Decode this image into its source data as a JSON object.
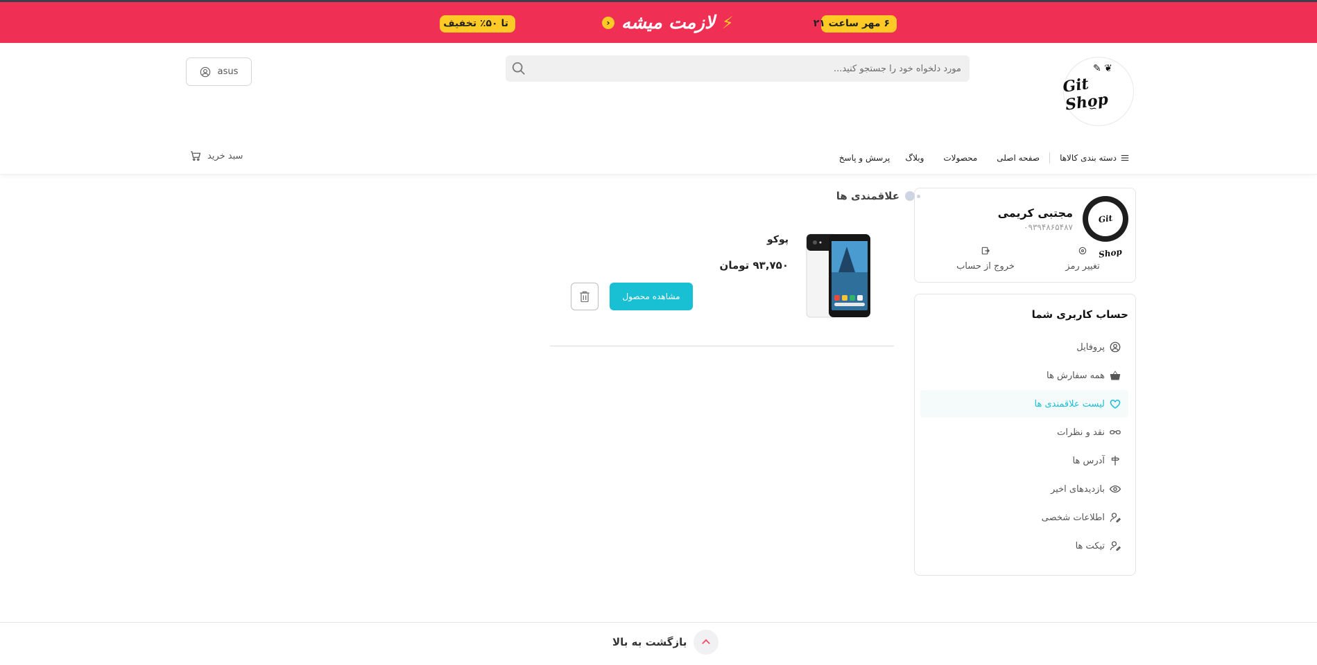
{
  "promo": {
    "discount_label": "تا ۵۰٪ تخفیف",
    "headline": "لازمت میشه",
    "date_label": "۶ مهر ساعت ۲۱",
    "bg_color": "#ef2f54",
    "pill_color": "#ffc926"
  },
  "header": {
    "logo_text": "Git Shop",
    "search_placeholder": "مورد دلخواه خود را جستجو کنید...",
    "user_label": "asus"
  },
  "nav": {
    "categories": "دسته بندی کالاها",
    "items": [
      "صفحه اصلی",
      "محصولات",
      "وبلاگ",
      "پرسش و پاسخ"
    ],
    "cart_label": "سبد خرید"
  },
  "profile": {
    "avatar_text": "Git Shop",
    "name": "مجتبی کریمی",
    "phone": "۰۹۳۹۴۸۶۵۴۸۷",
    "change_password": "تغییر رمز",
    "logout": "خروج از حساب"
  },
  "account_menu": {
    "title": "حساب کاربری شما",
    "items": [
      {
        "label": "پروفایل",
        "icon": "user-circle-icon"
      },
      {
        "label": "همه سفارش ها",
        "icon": "basket-icon"
      },
      {
        "label": "لیست علاقمندی ها",
        "icon": "heart-icon",
        "active": true
      },
      {
        "label": "نقد و نظرات",
        "icon": "glasses-icon"
      },
      {
        "label": "آدرس ها",
        "icon": "signpost-icon"
      },
      {
        "label": "بازدیدهای اخیر",
        "icon": "eye-icon"
      },
      {
        "label": "اطلاعات شخصی",
        "icon": "user-edit-icon"
      },
      {
        "label": "تیکت ها",
        "icon": "user-edit-icon"
      }
    ],
    "accent_color": "#19bfd3"
  },
  "wishlist": {
    "title": "علاقمندی ها",
    "product": {
      "name": "پوکو",
      "price": "۹۳,۷۵۰ تومان",
      "view_button": "مشاهده محصول"
    }
  },
  "footer": {
    "back_to_top": "بازگشت به بالا"
  }
}
